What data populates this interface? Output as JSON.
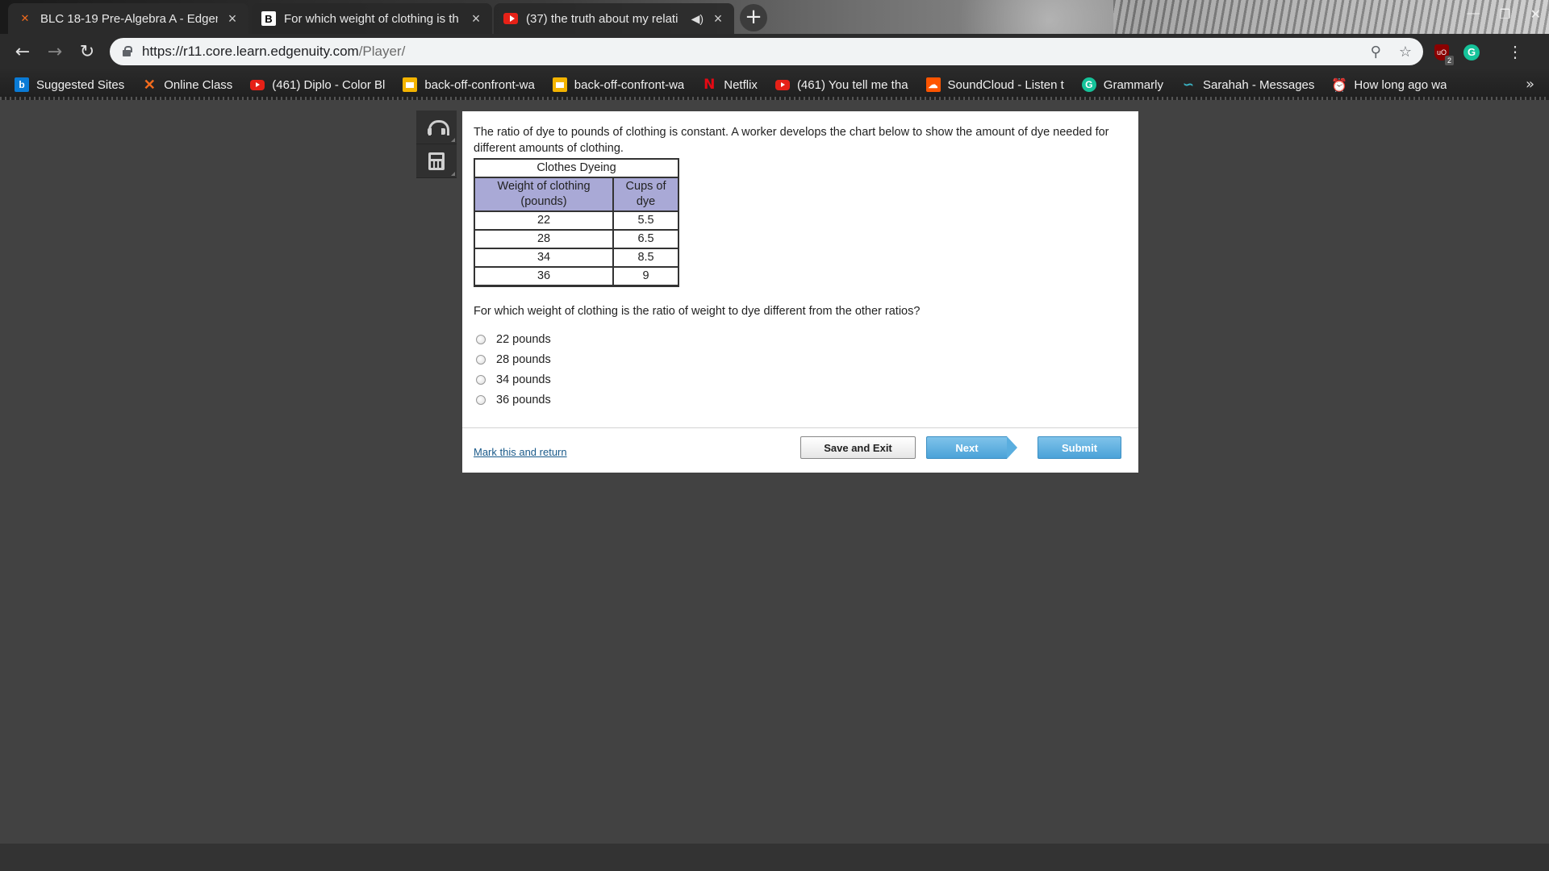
{
  "browser": {
    "tabs": [
      {
        "title": "BLC 18-19 Pre-Algebra A - Edgen",
        "icon": "edgenuity-x-icon",
        "active": true
      },
      {
        "title": "For which weight of clothing is th",
        "icon": "brainly-b-icon",
        "active": false
      },
      {
        "title": "(37) the truth about my relati",
        "icon": "youtube-icon",
        "active": false
      }
    ],
    "url": {
      "host": "https://r11.core.learn.edgenuity.com",
      "path": "/Player/"
    },
    "extension_badge": "2",
    "bookmarks": [
      {
        "label": "Suggested Sites",
        "icon": "bing-icon"
      },
      {
        "label": "Online Class",
        "icon": "edgenuity-x-icon"
      },
      {
        "label": "(461) Diplo - Color Bl",
        "icon": "youtube-icon"
      },
      {
        "label": "back-off-confront-wa",
        "icon": "slides-icon"
      },
      {
        "label": "back-off-confront-wa",
        "icon": "slides-icon"
      },
      {
        "label": "Netflix",
        "icon": "netflix-icon"
      },
      {
        "label": "(461) You tell me tha",
        "icon": "youtube-icon"
      },
      {
        "label": "SoundCloud - Listen t",
        "icon": "soundcloud-icon"
      },
      {
        "label": "Grammarly",
        "icon": "grammarly-icon"
      },
      {
        "label": "Sarahah - Messages",
        "icon": "sarahah-icon"
      },
      {
        "label": "How long ago wa",
        "icon": "alarm-clock-icon"
      }
    ]
  },
  "question": {
    "prompt": "The ratio of dye to pounds of clothing is constant. A worker develops the chart below to show the amount of dye needed for different amounts of clothing.",
    "table": {
      "caption": "Clothes Dyeing",
      "headers": [
        "Weight of clothing (pounds)",
        "Cups of dye"
      ],
      "rows": [
        [
          "22",
          "5.5"
        ],
        [
          "28",
          "6.5"
        ],
        [
          "34",
          "8.5"
        ],
        [
          "36",
          "9"
        ]
      ]
    },
    "text": "For which weight of clothing is the ratio of weight to dye different from the other ratios?",
    "choices": [
      "22 pounds",
      "28 pounds",
      "34 pounds",
      "36 pounds"
    ]
  },
  "footer": {
    "mark_link": "Mark this and return",
    "save_exit": "Save and Exit",
    "next": "Next",
    "submit": "Submit"
  },
  "colors": {
    "table_header": "#a9a9d6",
    "button_blue": "#4ba2d8",
    "page_background": "#424242"
  }
}
